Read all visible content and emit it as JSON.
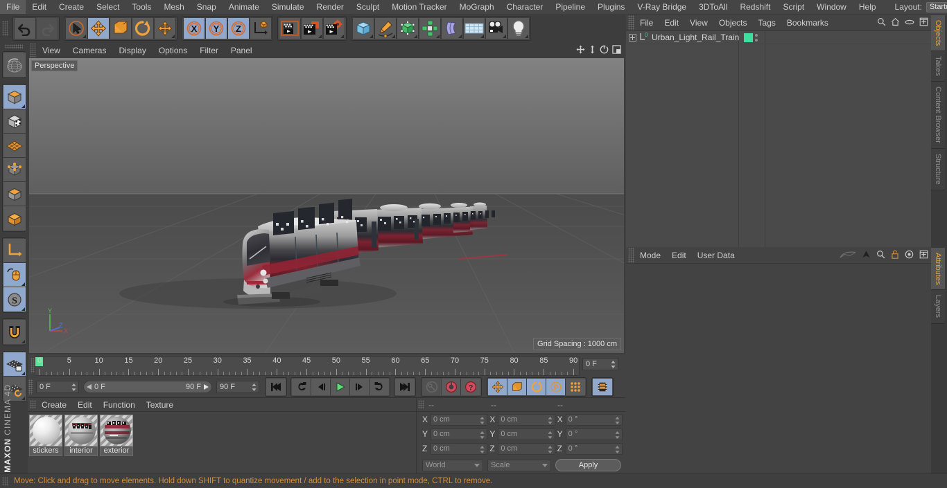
{
  "app": {
    "name": "MAXON CINEMA 4D",
    "brand_top": "MAXON",
    "brand_bottom": "CINEMA 4D"
  },
  "menubar": {
    "items": [
      "File",
      "Edit",
      "Create",
      "Select",
      "Tools",
      "Mesh",
      "Snap",
      "Animate",
      "Simulate",
      "Render",
      "Sculpt",
      "Motion Tracker",
      "MoGraph",
      "Character",
      "Pipeline",
      "Plugins",
      "V-Ray Bridge",
      "3DToAll",
      "Redshift",
      "Script",
      "Window",
      "Help"
    ],
    "layout_label": "Layout:",
    "layout_value": "Startup",
    "search_icon": "search-icon"
  },
  "toolbar": {
    "groups": [
      {
        "name": "history",
        "buttons": [
          {
            "icon": "undo-icon",
            "active": false,
            "disabled": false
          },
          {
            "icon": "redo-icon",
            "active": false,
            "disabled": true
          }
        ]
      },
      {
        "name": "transform-tools",
        "buttons": [
          {
            "icon": "live-selection-icon",
            "active": false,
            "corner": true
          },
          {
            "icon": "move-icon",
            "active": true
          },
          {
            "icon": "scale-icon",
            "active": false
          },
          {
            "icon": "rotate-icon",
            "active": false
          },
          {
            "icon": "move-duplicate-icon",
            "active": false,
            "corner": true
          }
        ]
      },
      {
        "name": "axis-locks",
        "buttons": [
          {
            "icon": "x-axis-icon",
            "active": true,
            "label": "X"
          },
          {
            "icon": "y-axis-icon",
            "active": true,
            "label": "Y"
          },
          {
            "icon": "z-axis-icon",
            "active": true,
            "label": "Z"
          },
          {
            "icon": "world-coordinate-icon",
            "active": false
          }
        ]
      },
      {
        "name": "render-tools",
        "buttons": [
          {
            "icon": "render-view-icon",
            "active": false
          },
          {
            "icon": "render-region-icon",
            "active": false,
            "corner": true
          },
          {
            "icon": "render-settings-icon",
            "active": false,
            "corner": true
          }
        ]
      },
      {
        "name": "object-creation",
        "buttons": [
          {
            "icon": "cube-primitive-icon",
            "active": false,
            "corner": true
          },
          {
            "icon": "pen-spline-icon",
            "active": false,
            "corner": true
          },
          {
            "icon": "generator-icon",
            "active": false,
            "corner": true
          },
          {
            "icon": "array-icon",
            "active": false,
            "corner": true
          },
          {
            "icon": "bend-deformer-icon",
            "active": false,
            "corner": true
          },
          {
            "icon": "floor-environment-icon",
            "active": false,
            "corner": true
          },
          {
            "icon": "camera-icon",
            "active": false,
            "corner": true
          },
          {
            "icon": "light-icon",
            "active": false,
            "corner": true
          }
        ]
      }
    ]
  },
  "left_toolbar": {
    "groups": [
      {
        "buttons": [
          {
            "icon": "undo-view-icon",
            "active": false
          }
        ]
      },
      {
        "buttons": [
          {
            "icon": "model-mode-icon",
            "active": true,
            "corner": true
          },
          {
            "icon": "texture-mode-icon",
            "active": false
          },
          {
            "icon": "polygon-mode-icon",
            "active": false
          },
          {
            "icon": "point-mode-icon",
            "active": false
          },
          {
            "icon": "edge-mode-icon",
            "active": false
          },
          {
            "icon": "object-mode-icon",
            "active": false
          }
        ]
      },
      {
        "buttons": [
          {
            "icon": "axis-modify-icon",
            "active": false
          },
          {
            "icon": "viewport-solo-icon",
            "active": true,
            "corner": true
          },
          {
            "icon": "enable-snap-icon",
            "active": true,
            "corner": true
          }
        ]
      },
      {
        "buttons": [
          {
            "icon": "magnet-icon",
            "active": false,
            "corner": true
          }
        ]
      },
      {
        "buttons": [
          {
            "icon": "workplane-lock-icon",
            "active": true,
            "corner": true
          },
          {
            "icon": "workplane-rotate-icon",
            "active": false,
            "corner": true
          }
        ]
      }
    ]
  },
  "viewport": {
    "menu": [
      "View",
      "Cameras",
      "Display",
      "Options",
      "Filter",
      "Panel"
    ],
    "corner_icons": [
      "pan-icon",
      "dolly-icon",
      "rotate-view-icon",
      "maximize-viewport-icon"
    ],
    "label": "Perspective",
    "grid_spacing": "Grid Spacing : 1000 cm",
    "axis_gizmo": {
      "x": "X",
      "y": "Y",
      "z": "Z",
      "x_color": "#e05050",
      "y_color": "#5fd05f",
      "z_color": "#5a6ee0"
    },
    "scene_object": "Urban_Light_Rail_Train"
  },
  "timeline": {
    "ticks": [
      0,
      5,
      10,
      15,
      20,
      25,
      30,
      35,
      40,
      45,
      50,
      55,
      60,
      65,
      70,
      75,
      80,
      85,
      90
    ],
    "range_start": 0,
    "range_end": 90,
    "current_frame_display": "0 F",
    "frame_field_left": "0 F",
    "slider_start": "0 F",
    "slider_end": "90 F",
    "frame_field_right": "90 F",
    "transport": [
      {
        "icon": "go-to-start-icon",
        "active": false
      },
      {
        "icon": "previous-key-icon",
        "active": false
      },
      {
        "icon": "step-back-icon",
        "active": false
      },
      {
        "icon": "play-icon",
        "active": false
      },
      {
        "icon": "step-forward-icon",
        "active": false
      },
      {
        "icon": "next-key-icon",
        "active": false
      },
      {
        "icon": "go-to-end-icon",
        "active": false
      }
    ],
    "record_group": [
      {
        "icon": "autokey-icon",
        "active": false,
        "disabled": true
      },
      {
        "icon": "record-active-objects-icon",
        "active": false
      },
      {
        "icon": "keyframe-selection-icon",
        "active": false
      }
    ],
    "key_toggles": [
      {
        "icon": "record-position-icon",
        "active": true
      },
      {
        "icon": "record-scale-icon",
        "active": true
      },
      {
        "icon": "record-rotation-icon",
        "active": true
      },
      {
        "icon": "record-parameter-icon",
        "active": true
      },
      {
        "icon": "record-pla-icon",
        "active": false
      }
    ],
    "extra": [
      {
        "icon": "timeline-icon",
        "active": true
      }
    ]
  },
  "material_manager": {
    "menu": [
      "Create",
      "Edit",
      "Function",
      "Texture"
    ],
    "materials": [
      {
        "name": "stickers",
        "type": "plain-white"
      },
      {
        "name": "interior",
        "type": "textured-interior"
      },
      {
        "name": "exterior",
        "type": "textured-exterior"
      }
    ]
  },
  "coordinates": {
    "headers": [
      "--",
      "--",
      "--"
    ],
    "rows": [
      {
        "axis": "X",
        "position": "0 cm",
        "size": "0 cm",
        "rotation": "0 °"
      },
      {
        "axis": "Y",
        "position": "0 cm",
        "size": "0 cm",
        "rotation": "0 °"
      },
      {
        "axis": "Z",
        "position": "0 cm",
        "size": "0 cm",
        "rotation": "0 °"
      }
    ],
    "system_dropdown": "World",
    "mode_dropdown": "Scale",
    "apply_button": "Apply"
  },
  "object_manager": {
    "menu": [
      "File",
      "Edit",
      "View",
      "Objects",
      "Tags",
      "Bookmarks"
    ],
    "icons": [
      "search-icon",
      "home-icon",
      "ellipse-icon",
      "add-layer-icon"
    ],
    "objects": [
      {
        "name": "Urban_Light_Rail_Train",
        "layer_color": "#3ddfa0",
        "expandable": true,
        "tag": "0"
      }
    ]
  },
  "attribute_manager": {
    "menu": [
      "Mode",
      "Edit",
      "User Data"
    ],
    "icons": [
      "curve-icon",
      "arrow-icon",
      "search-icon",
      "lock-icon",
      "target-icon",
      "add-icon"
    ],
    "content": ""
  },
  "right_tabs_upper": [
    "Objects",
    "Takes",
    "Content Browser",
    "Structure"
  ],
  "right_tabs_lower": [
    "Attributes",
    "Layers"
  ],
  "statusbar": {
    "text": "Move: Click and drag to move elements. Hold down SHIFT to quantize movement / add to the selection in point mode, CTRL to remove.",
    "color": "#d28f3a"
  },
  "colors": {
    "accent_orange": "#e8a13c",
    "active_blue": "#8fa8cc",
    "panel_bg": "#434343",
    "toolbar_bg": "#3d3d3d"
  }
}
